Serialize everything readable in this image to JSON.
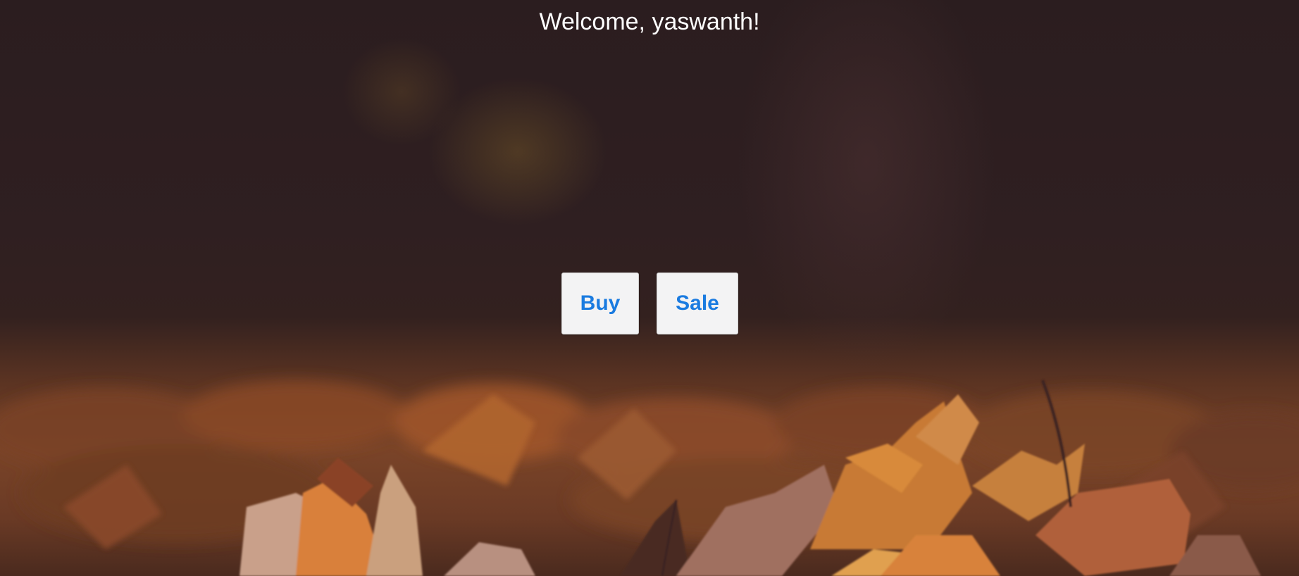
{
  "header": {
    "welcome_text": "Welcome, yaswanth!"
  },
  "actions": {
    "buy_label": "Buy",
    "sale_label": "Sale"
  },
  "colors": {
    "button_text": "#1a7be0",
    "button_bg": "#f3f3f4",
    "welcome_text": "#ffffff"
  }
}
